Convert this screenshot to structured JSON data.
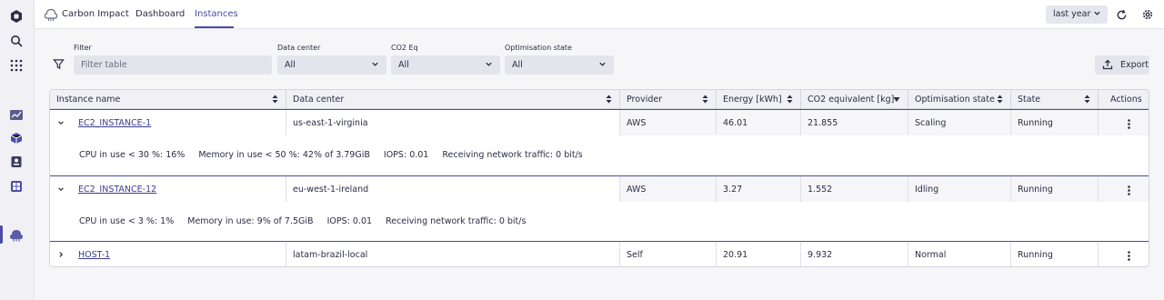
{
  "app": {
    "title": "Carbon Impact",
    "nav_tabs": [
      {
        "label": "Dashboard",
        "active": false
      },
      {
        "label": "Instances",
        "active": true
      }
    ],
    "timeframe": "last year",
    "accent_color": "#4b4ba8"
  },
  "rail": {
    "icons": [
      "app-logo-icon",
      "search-icon",
      "apps-grid-icon",
      "chart-icon",
      "cube-icon",
      "book-icon",
      "dashboard-icon",
      "carbon-impact-icon"
    ]
  },
  "filters": {
    "filter_label": "Filter",
    "filter_placeholder": "Filter table",
    "data_center_label": "Data center",
    "data_center_value": "All",
    "co2_label": "CO2 Eq",
    "co2_value": "All",
    "optimisation_label": "Optimisation state",
    "optimisation_value": "All",
    "export_label": "Export"
  },
  "table": {
    "columns": [
      "Instance name",
      "Data center",
      "Provider",
      "Energy [kWh]",
      "CO2 equivalent [kg]",
      "Optimisation state",
      "State",
      "Actions"
    ],
    "rows": [
      {
        "instance": "EC2_INSTANCE-1",
        "data_center": "us-east-1-virginia",
        "provider": "AWS",
        "energy": "46.01",
        "co2": "21.855",
        "optimisation": "Scaling",
        "state": "Running",
        "expanded": true,
        "details": [
          {
            "label": "CPU in use < 30 %:",
            "value": "16%"
          },
          {
            "label": "Memory in use < 50 %:",
            "value": "42% of 3.79GiB"
          },
          {
            "label": "IOPS:",
            "value": "0.01"
          },
          {
            "label": "Receiving network traffic:",
            "value": "0 bit/s"
          }
        ]
      },
      {
        "instance": "EC2_INSTANCE-12",
        "data_center": "eu-west-1-ireland",
        "provider": "AWS",
        "energy": "3.27",
        "co2": "1.552",
        "optimisation": "Idling",
        "state": "Running",
        "expanded": true,
        "details": [
          {
            "label": "CPU in use < 3 %:",
            "value": "1%"
          },
          {
            "label": "Memory in use:",
            "value": "9% of 7.5GiB"
          },
          {
            "label": "IOPS:",
            "value": "0.01"
          },
          {
            "label": "Receiving network traffic:",
            "value": "0 bit/s"
          }
        ]
      },
      {
        "instance": "HOST-1",
        "data_center": "latam-brazil-local",
        "provider": "Self",
        "energy": "20.91",
        "co2": "9.932",
        "optimisation": "Normal",
        "state": "Running",
        "expanded": false,
        "details": []
      }
    ]
  }
}
